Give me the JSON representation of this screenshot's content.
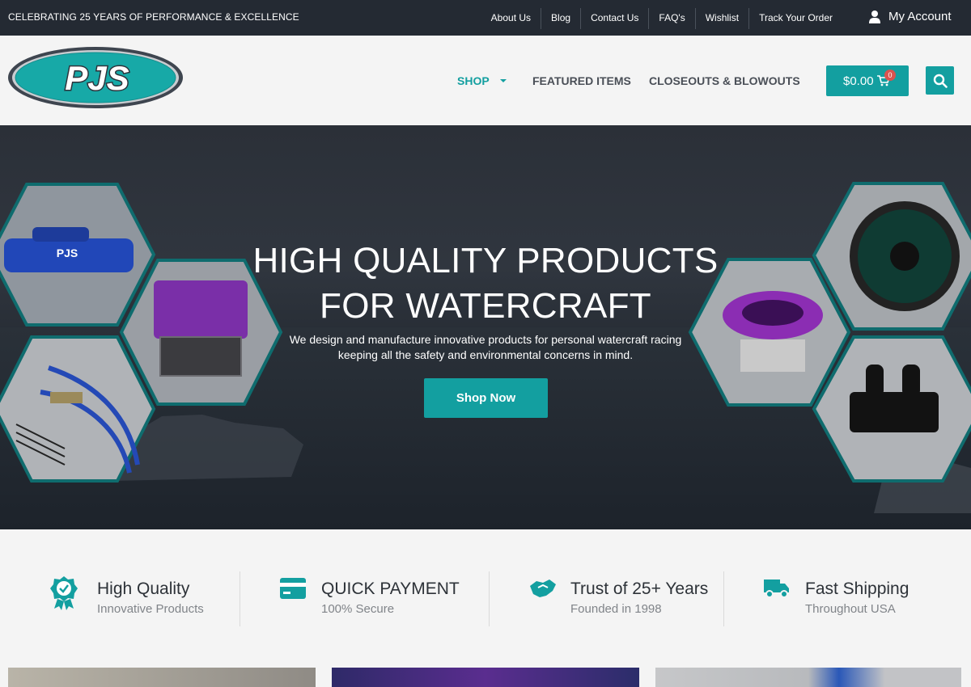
{
  "topbar": {
    "promo": "CELEBRATING 25 YEARS OF PERFORMANCE & EXCELLENCE",
    "links": [
      "About Us",
      "Blog",
      "Contact Us",
      "FAQ's",
      "Wishlist",
      "Track Your Order"
    ],
    "account": "My Account"
  },
  "header": {
    "logo_text": "PJS",
    "nav": {
      "shop": "SHOP",
      "featured": "FEATURED ITEMS",
      "closeouts": "CLOSEOUTS & BLOWOUTS"
    },
    "cart": {
      "amount": "$0.00",
      "count": "0"
    }
  },
  "hero": {
    "title_line1": "HIGH QUALITY PRODUCTS",
    "title_line2": "FOR WATERCRAFT",
    "subtitle_line1": "We design and manufacture innovative products for personal watercraft racing",
    "subtitle_line2": "keeping all the safety and environmental concerns in mind.",
    "cta": "Shop Now"
  },
  "features": [
    {
      "title": "High Quality",
      "subtitle": "Innovative Products",
      "icon": "badge-check-icon"
    },
    {
      "title": "QUICK PAYMENT",
      "subtitle": "100% Secure",
      "icon": "credit-card-icon"
    },
    {
      "title": "Trust of 25+ Years",
      "subtitle": "Founded in 1998",
      "icon": "handshake-icon"
    },
    {
      "title": "Fast Shipping",
      "subtitle": "Throughout USA",
      "icon": "truck-icon"
    }
  ],
  "colors": {
    "accent": "#139fa0",
    "topbar": "#242a33",
    "badge": "#d9534f"
  }
}
